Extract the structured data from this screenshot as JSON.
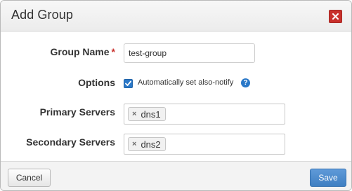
{
  "dialog": {
    "title": "Add Group",
    "close_icon": "close-icon"
  },
  "form": {
    "group_name": {
      "label": "Group Name",
      "required_marker": "*",
      "value": "test-group"
    },
    "options": {
      "label": "Options",
      "checkbox_label": "Automatically set also-notify",
      "checked": true,
      "help_icon": "question-circle-icon",
      "help_glyph": "?"
    },
    "primary_servers": {
      "label": "Primary Servers",
      "tags": [
        {
          "remove": "×",
          "text": "dns1"
        }
      ]
    },
    "secondary_servers": {
      "label": "Secondary Servers",
      "tags": [
        {
          "remove": "×",
          "text": "dns2"
        }
      ]
    }
  },
  "footer": {
    "cancel_label": "Cancel",
    "save_label": "Save"
  },
  "colors": {
    "accent": "#2a78c8",
    "danger": "#c9302c",
    "primary_button": "#4a88c9"
  }
}
